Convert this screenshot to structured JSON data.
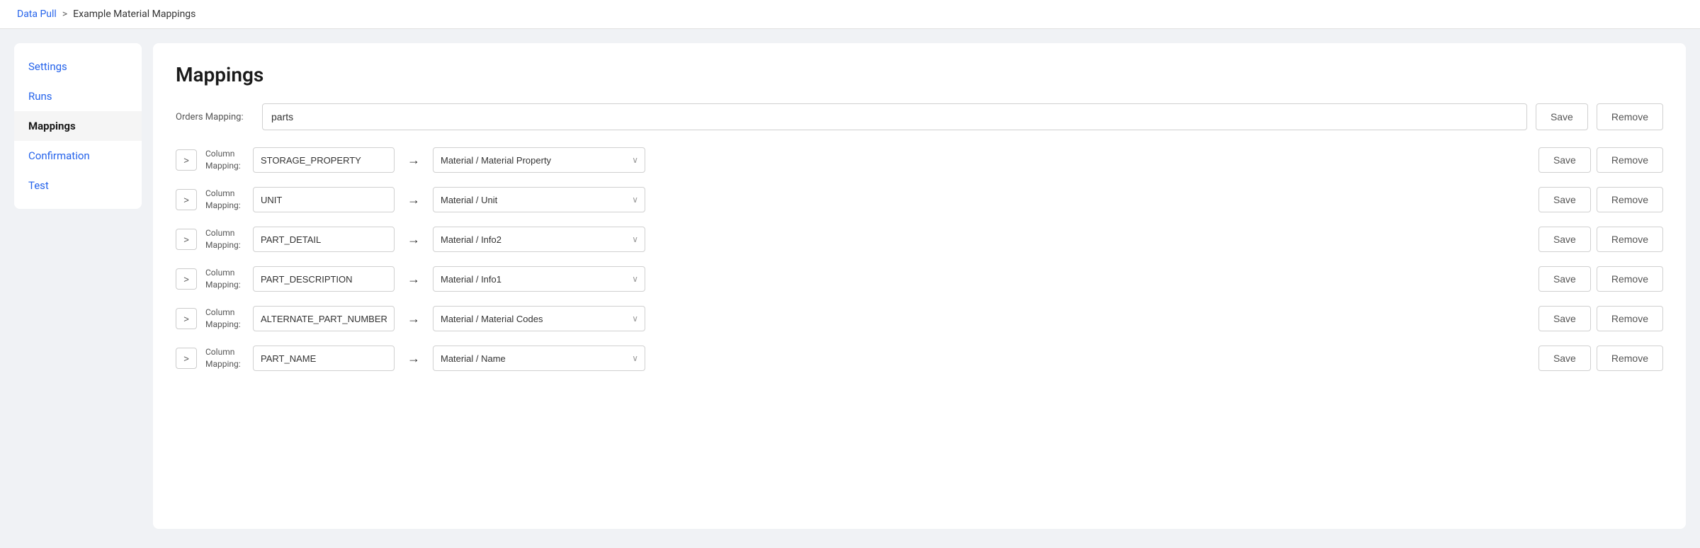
{
  "breadcrumb": {
    "link": "Data Pull",
    "separator": ">",
    "current": "Example Material Mappings"
  },
  "sidebar": {
    "items": [
      {
        "label": "Settings",
        "active": false
      },
      {
        "label": "Runs",
        "active": false
      },
      {
        "label": "Mappings",
        "active": true
      },
      {
        "label": "Confirmation",
        "active": false
      },
      {
        "label": "Test",
        "active": false
      }
    ]
  },
  "main": {
    "title": "Mappings",
    "orders_mapping_label": "Orders Mapping:",
    "orders_mapping_value": "parts",
    "save_label": "Save",
    "remove_label": "Remove",
    "mappings": [
      {
        "expand_icon": ">",
        "column_label": "Column\nMapping:",
        "column_value": "STORAGE_PROPERTY",
        "destination": "Material / Material Property",
        "save_label": "Save",
        "remove_label": "Remove"
      },
      {
        "expand_icon": ">",
        "column_label": "Column\nMapping:",
        "column_value": "UNIT",
        "destination": "Material / Unit",
        "save_label": "Save",
        "remove_label": "Remove"
      },
      {
        "expand_icon": ">",
        "column_label": "Column\nMapping:",
        "column_value": "PART_DETAIL",
        "destination": "Material / Info2",
        "save_label": "Save",
        "remove_label": "Remove"
      },
      {
        "expand_icon": ">",
        "column_label": "Column\nMapping:",
        "column_value": "PART_DESCRIPTION",
        "destination": "Material / Info1",
        "save_label": "Save",
        "remove_label": "Remove"
      },
      {
        "expand_icon": ">",
        "column_label": "Column\nMapping:",
        "column_value": "ALTERNATE_PART_NUMBERS",
        "destination": "Material / Material Codes",
        "save_label": "Save",
        "remove_label": "Remove"
      },
      {
        "expand_icon": ">",
        "column_label": "Column\nMapping:",
        "column_value": "PART_NAME",
        "destination": "Material / Name",
        "save_label": "Save",
        "remove_label": "Remove"
      }
    ]
  }
}
